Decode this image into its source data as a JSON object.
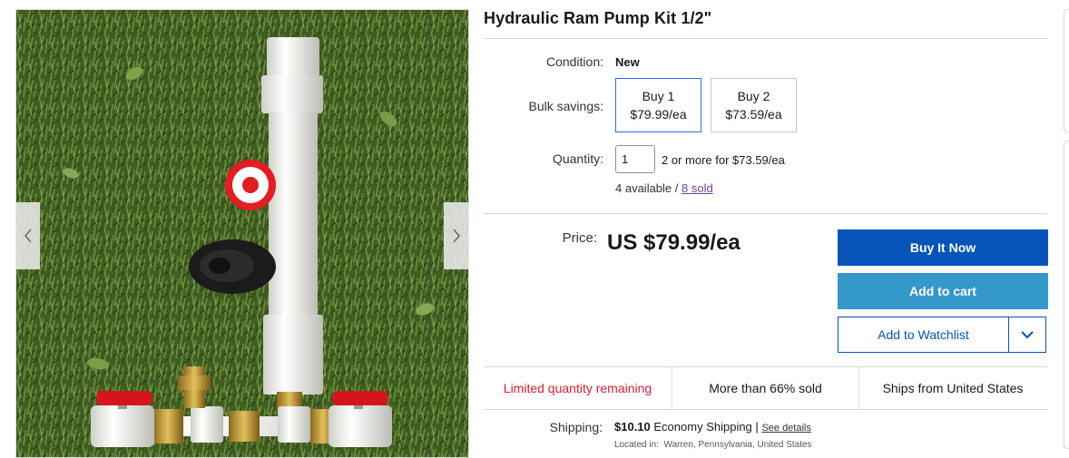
{
  "listing": {
    "title": "Hydraulic Ram Pump Kit 1/2\""
  },
  "condition": {
    "label": "Condition:",
    "value": "New"
  },
  "bulk_savings": {
    "label": "Bulk savings:",
    "options": [
      {
        "line1": "Buy 1",
        "line2": "$79.99/ea",
        "selected": true
      },
      {
        "line1": "Buy 2",
        "line2": "$73.59/ea",
        "selected": false
      }
    ]
  },
  "quantity": {
    "label": "Quantity:",
    "value": "1",
    "promo": "2 or more for $73.59/ea",
    "available_text": "4 available / ",
    "sold_link": "8 sold"
  },
  "price": {
    "label": "Price:",
    "value": "US $79.99/ea"
  },
  "actions": {
    "buy_now": "Buy It Now",
    "add_to_cart": "Add to cart",
    "add_to_watchlist": "Add to Watchlist"
  },
  "signals": [
    {
      "text": "Limited quantity remaining",
      "color": "#dd1e31"
    },
    {
      "text": "More than 66% sold"
    },
    {
      "text": "Ships from United States"
    }
  ],
  "shipping": {
    "label": "Shipping:",
    "cost": "$10.10",
    "method": "Economy Shipping",
    "separator": "|",
    "details_link": "See details",
    "located_label": "Located in:",
    "located_value": "Warren, Pennsylvania, United States"
  },
  "icons": {
    "prev": "chevron-left-icon",
    "next": "chevron-right-icon",
    "dropdown": "chevron-down-icon"
  },
  "colors": {
    "primary_button": "#0654ba",
    "secondary_button": "#3498ca",
    "alert_text": "#dd1e31",
    "selected_border": "#3665f3"
  }
}
